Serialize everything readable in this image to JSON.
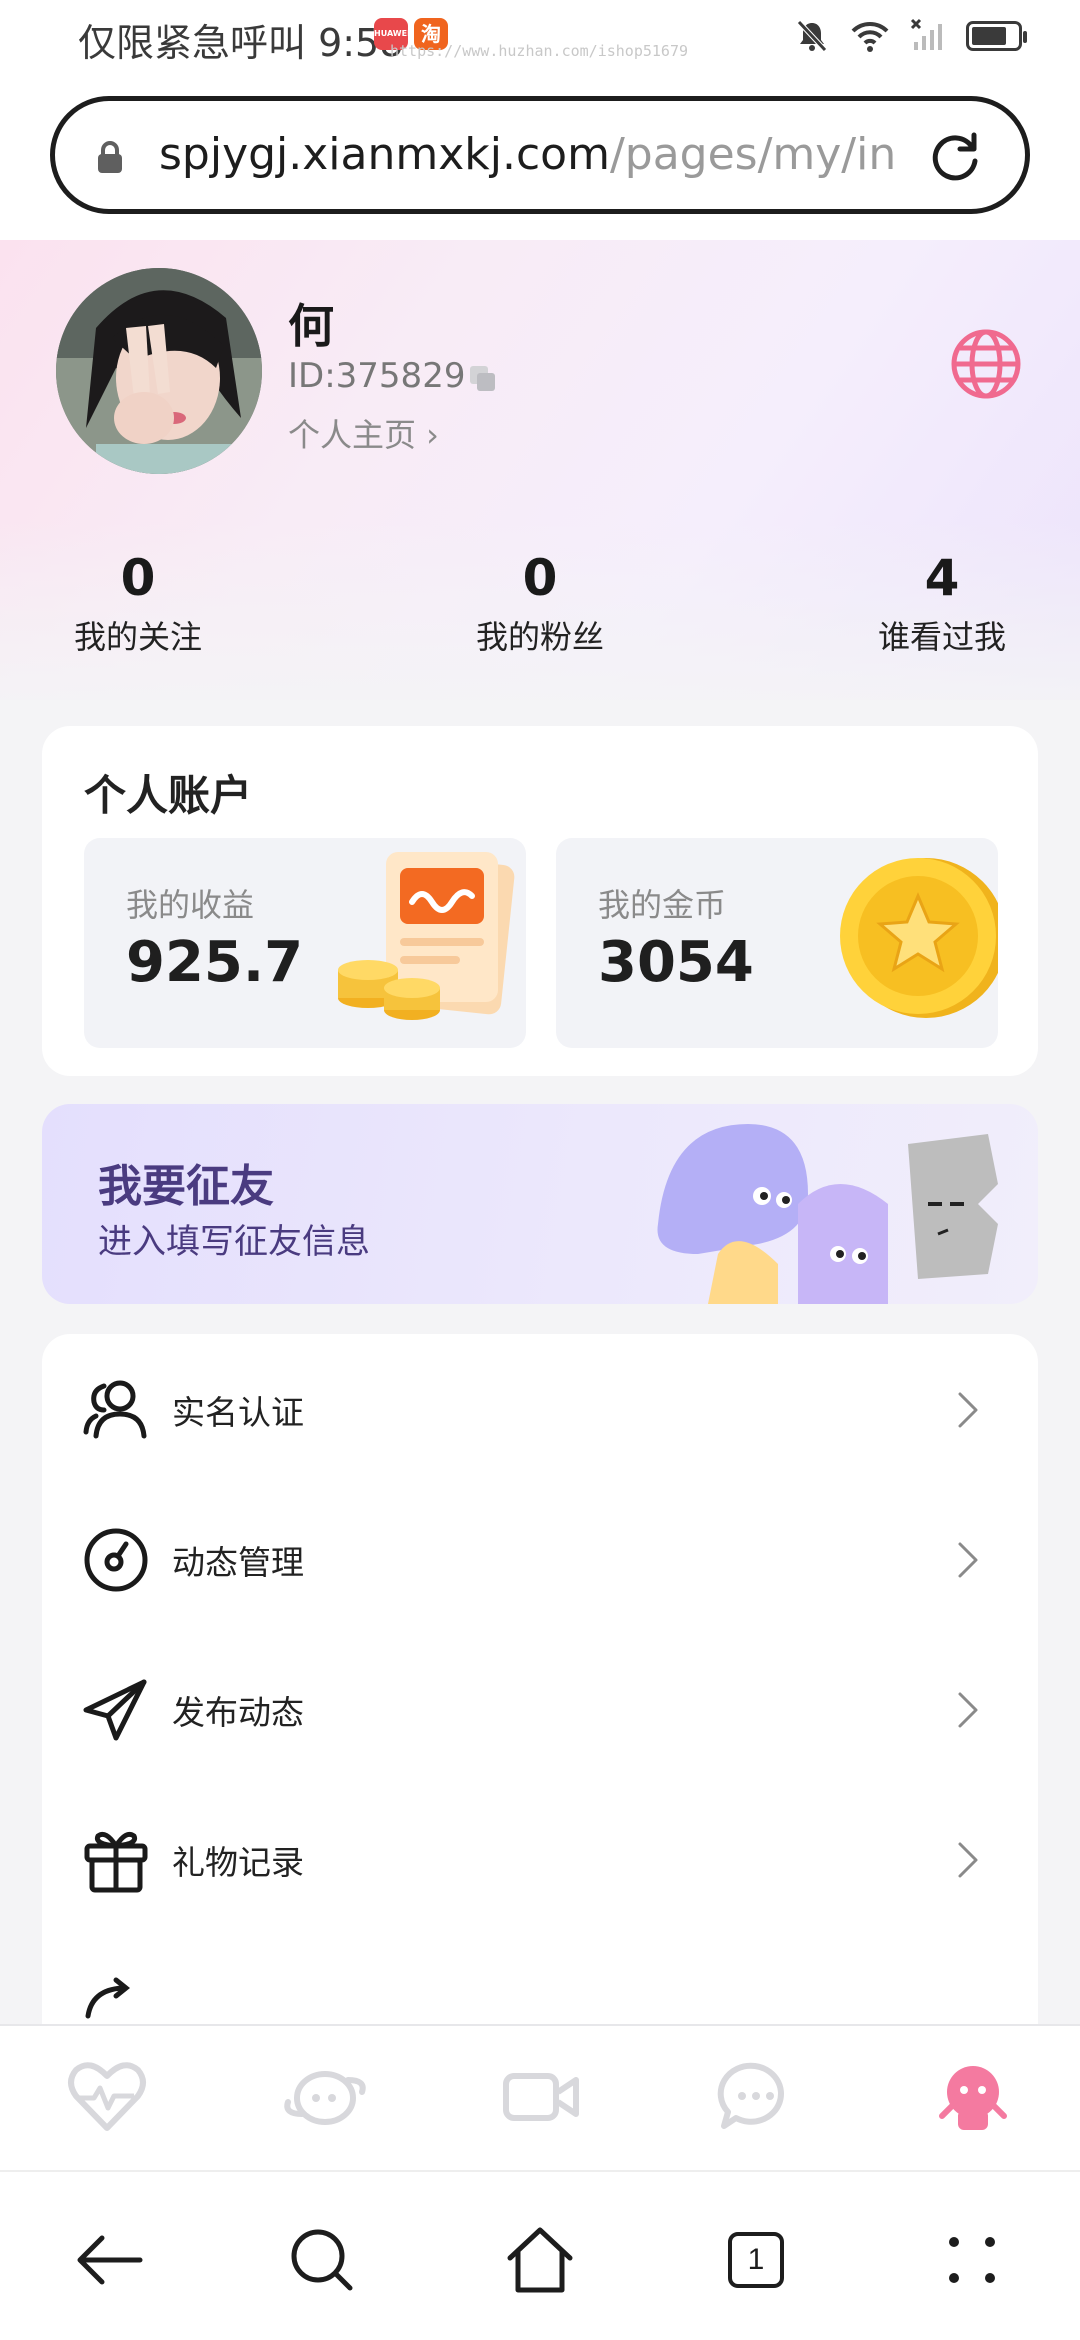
{
  "status_bar": {
    "text": "仅限紧急呼叫 9:58",
    "badge_a": "HUAWEI",
    "badge_b": "淘",
    "watermark": "https://www.huzhan.com/ishop51679"
  },
  "browser": {
    "url_host": "spjygj.xianmxkj.com",
    "url_path": "/pages/my/in"
  },
  "profile": {
    "name": "何",
    "id": "ID:375829",
    "homepage_link": "个人主页 ›"
  },
  "stats": [
    {
      "value": "0",
      "label": "我的关注"
    },
    {
      "value": "0",
      "label": "我的粉丝"
    },
    {
      "value": "4",
      "label": "谁看过我"
    }
  ],
  "account": {
    "title": "个人账户",
    "earnings_label": "我的收益",
    "earnings_value": "925.7",
    "coins_label": "我的金币",
    "coins_value": "3054"
  },
  "recruit": {
    "title": "我要征友",
    "subtitle": "进入填写征友信息"
  },
  "menu": [
    {
      "label": "实名认证",
      "icon": "users-icon"
    },
    {
      "label": "动态管理",
      "icon": "gauge-icon"
    },
    {
      "label": "发布动态",
      "icon": "send-icon"
    },
    {
      "label": "礼物记录",
      "icon": "gift-icon"
    }
  ],
  "tab_bar": [
    {
      "icon": "heart-pulse-icon",
      "active": false
    },
    {
      "icon": "planet-chat-icon",
      "active": false
    },
    {
      "icon": "video-icon",
      "active": false
    },
    {
      "icon": "message-icon",
      "active": false
    },
    {
      "icon": "mascot-icon",
      "active": true
    }
  ],
  "browser_nav": {
    "tab_count": "1"
  },
  "colors": {
    "accent_pink": "#f06a8f",
    "recruit_text": "#4a3b80",
    "inactive_tab": "#c9c9cf"
  }
}
